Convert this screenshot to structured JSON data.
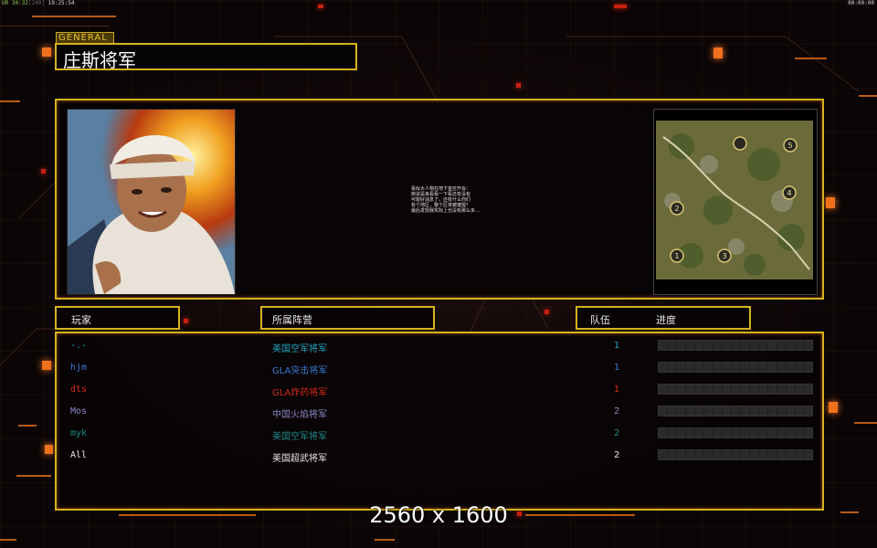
{
  "status": {
    "left_prefix": "UR",
    "left_a": "30:32",
    "left_b": "[240]",
    "left_time": "19:25:54",
    "right_time": "00:00:00"
  },
  "general": {
    "tag": "GENERAL",
    "name": "庄斯将军"
  },
  "briefing_lines": "看似大人物在地下室召开会：\n她说是来看看一下看还有没有\n可能好消息了，还有什么你们\n有个地区，整个区将被摧毁？\n最后发现我实际上也没有那么多…",
  "headers": {
    "player": "玩家",
    "faction": "所属阵营",
    "team": "队伍",
    "progress": "进度"
  },
  "players": [
    {
      "name": "-.-",
      "faction": "美国空军将军",
      "team": "1",
      "color": "#21a3c0"
    },
    {
      "name": "hjm",
      "faction": "GLA突击将军",
      "team": "1",
      "color": "#3a7cd6"
    },
    {
      "name": "dts",
      "faction": "GLA炸药将军",
      "team": "1",
      "color": "#d42a1c"
    },
    {
      "name": "Mos",
      "faction": "中国火焰将军",
      "team": "2",
      "color": "#8d86c9"
    },
    {
      "name": "myk",
      "faction": "美国空军将军",
      "team": "2",
      "color": "#1f8a8a"
    },
    {
      "name": "All",
      "faction": "美国超武将军",
      "team": "2",
      "color": "#e6e6e6"
    }
  ],
  "map_markers": [
    "1",
    "2",
    "3",
    "4",
    "5"
  ],
  "resolution_label": "2560 x 1600",
  "colors": {
    "frame": "#d6b21e",
    "accent": "#f0701c"
  }
}
